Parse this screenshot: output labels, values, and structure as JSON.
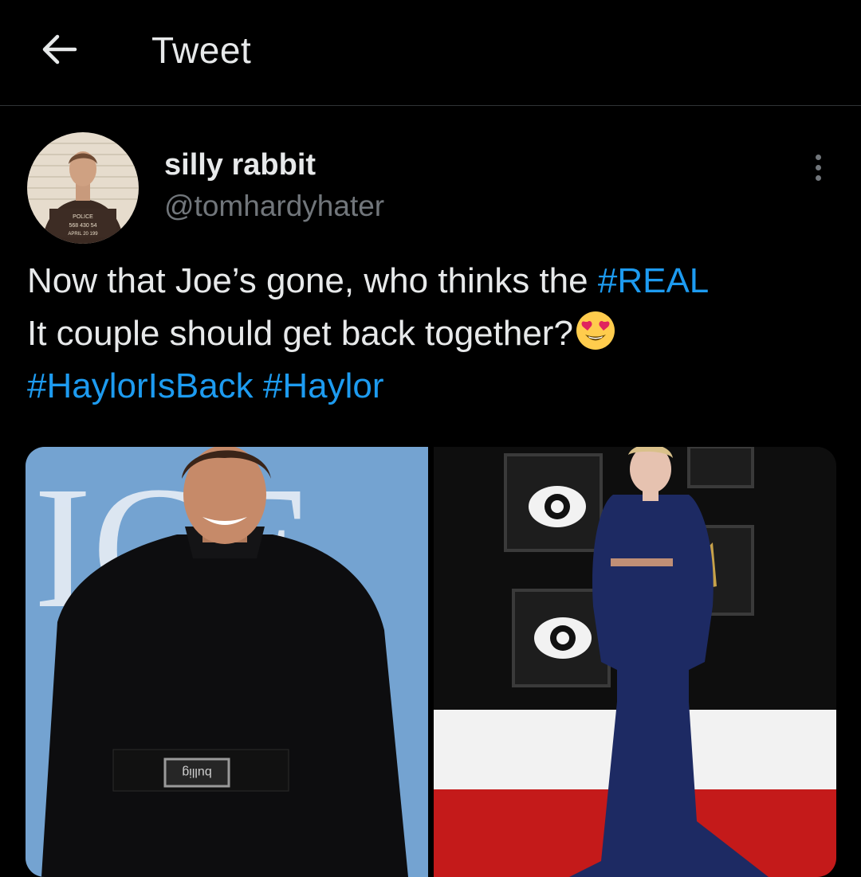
{
  "header": {
    "title": "Tweet",
    "back_icon": "arrow-left-icon"
  },
  "tweet": {
    "author": {
      "display_name": "silly rabbit",
      "handle": "@tomhardyhater",
      "avatar_placard": [
        "POLICE",
        "568 430 54",
        "APRIL 20 199"
      ]
    },
    "more_icon": "more-vertical-icon",
    "text": {
      "line1": "Now that Joe’s gone, who thinks the ",
      "hashtag1": "#REAL",
      "line2": "It couple should get back together?",
      "emoji": "smiling-face-with-heart-eyes",
      "hashtag2": "#HaylorIsBack",
      "hashtag3": "#Haylor"
    },
    "media": [
      {
        "alt": "man in black suit at event",
        "backdrop_letters": "ICE",
        "belt_text": "bullig"
      },
      {
        "alt": "woman in navy sequin gown on red carpet"
      }
    ]
  },
  "colors": {
    "background": "#000000",
    "text": "#e7e9ea",
    "secondary": "#71767b",
    "link": "#1d9bf0",
    "divider": "#2f3336"
  }
}
